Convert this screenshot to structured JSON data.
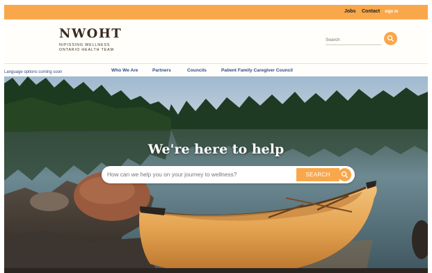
{
  "topbar": {
    "jobs": "Jobs",
    "contact": "Contact",
    "sign_in": "sign in"
  },
  "logo": {
    "mark": "NWOHT",
    "line1": "NIPISSING WELLNESS",
    "line2": "ONTARIO HEALTH TEAM"
  },
  "header_search": {
    "placeholder": "Search"
  },
  "nav": {
    "items": [
      "Who We Are",
      "Partners",
      "Councils",
      "Patient Family Caregiver Council"
    ],
    "language_note": "Language options coming soon"
  },
  "hero": {
    "title": "We're here to help",
    "search_placeholder": "How can we help you on your journey to wellness?",
    "search_button": "SEARCH"
  },
  "colors": {
    "accent": "#f9a74b",
    "nav_link": "#2d4b8c",
    "logo": "#3a2a1d"
  },
  "icons": {
    "header_search": "search-icon",
    "hero_search": "search-icon",
    "hero_image": "canoe-lake-photo"
  }
}
